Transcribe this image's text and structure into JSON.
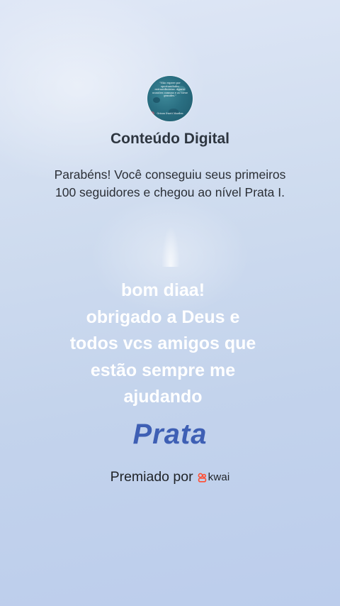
{
  "profile": {
    "avatar_quote": "\"Não espere por oportunidades extraordinárias. Agarre ocasiões comuns e as torne grandes.\"",
    "avatar_author": "Orison Swett Marden",
    "name": "Conteúdo Digital"
  },
  "announcement": {
    "text": "Parabéns! Você conseguiu seus primeiros 100 seguidores e chegou ao nível Prata I."
  },
  "user_message": {
    "lines": [
      "bom diaa!",
      "obrigado a Deus e",
      "todos vcs amigos que",
      "estão sempre me",
      "ajudando"
    ]
  },
  "level": {
    "name": "Prata"
  },
  "award": {
    "label": "Premiado por",
    "brand": "kwai",
    "brand_icon": "kwai-logo-icon"
  },
  "colors": {
    "level_text": "#3e5fb4",
    "kwai_accent": "#ff4e33",
    "title_text": "#2e3640"
  }
}
